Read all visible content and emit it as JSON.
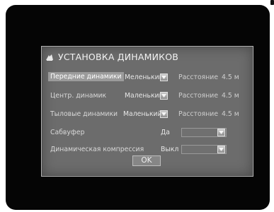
{
  "dialog": {
    "title": "УСТАНОВКА ДИНАМИКОВ",
    "title_icon": "speaker-setup-icon",
    "rows": [
      {
        "label": "Передние динамики",
        "value": "Меленький",
        "distance_label": "Расстояние",
        "distance_value": "4.5  м"
      },
      {
        "label": "Центр. динамик",
        "value": "Маленький",
        "distance_label": "Расстояние",
        "distance_value": "4.5  м"
      },
      {
        "label": "Тыловые динамики",
        "value": "Маленький",
        "distance_label": "Расстояние",
        "distance_value": "4.5  м"
      },
      {
        "label": "Сабвуфер",
        "value": "Да"
      },
      {
        "label": "Динамическая компрессия",
        "value": "Выкл"
      }
    ],
    "ok_label": "OK",
    "colors": {
      "panel": "#6c6c6c",
      "highlight": "#9b9b9b",
      "screen": "#050505"
    }
  }
}
